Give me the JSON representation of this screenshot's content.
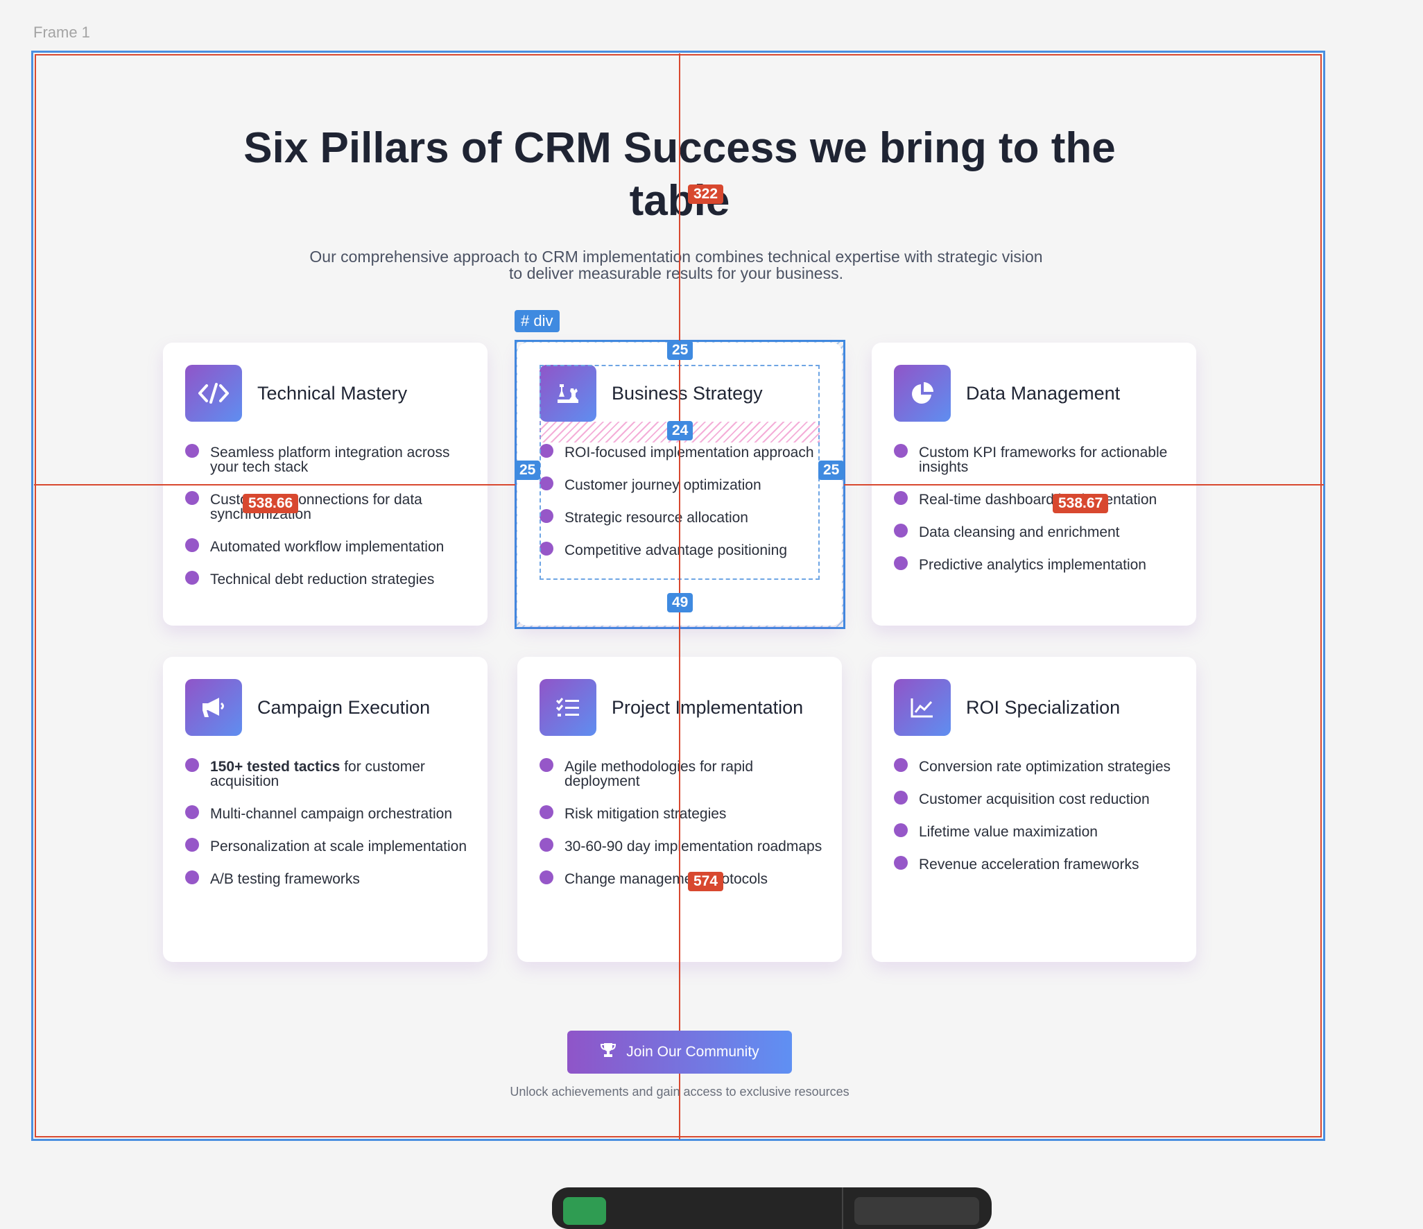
{
  "frame": {
    "label": "Frame 1"
  },
  "header": {
    "title": "Six Pillars of CRM Success we bring to the table",
    "subtitle": "Our comprehensive approach to CRM implementation combines technical expertise with strategic vision to deliver measurable results for your business."
  },
  "cards": [
    {
      "title": "Technical Mastery",
      "icon": "code-icon",
      "items": [
        "Seamless platform integration across your tech stack",
        "Custom API connections for data synchronization",
        "Automated workflow implementation",
        "Technical debt reduction strategies"
      ]
    },
    {
      "title": "Business Strategy",
      "icon": "chess-icon",
      "items": [
        "ROI-focused implementation approach",
        "Customer journey optimization",
        "Strategic resource allocation",
        "Competitive advantage positioning"
      ]
    },
    {
      "title": "Data Management",
      "icon": "pie-chart-icon",
      "items": [
        "Custom KPI frameworks for actionable insights",
        "Real-time dashboard implementation",
        "Data cleansing and enrichment",
        "Predictive analytics implementation"
      ]
    },
    {
      "title": "Campaign Execution",
      "icon": "megaphone-icon",
      "items_bold_prefix": "150+ tested tactics",
      "items": [
        " for customer acquisition",
        "Multi-channel campaign orchestration",
        "Personalization at scale implementation",
        "A/B testing frameworks"
      ]
    },
    {
      "title": "Project Implementation",
      "icon": "tasks-icon",
      "items": [
        "Agile methodologies for rapid deployment",
        "Risk mitigation strategies",
        "30-60-90 day implementation roadmaps",
        "Change management protocols"
      ]
    },
    {
      "title": "ROI Specialization",
      "icon": "line-chart-icon",
      "items": [
        "Conversion rate optimization strategies",
        "Customer acquisition cost reduction",
        "Lifetime value maximization",
        "Revenue acceleration frameworks"
      ]
    }
  ],
  "cta": {
    "label": "Join Our Community",
    "note": "Unlock achievements and gain access to exclusive resources",
    "icon": "trophy-icon"
  },
  "inspector": {
    "tag": "div",
    "padding_top": "25",
    "padding_left": "25",
    "padding_right": "25",
    "padding_bottom": "49",
    "gap": "24",
    "dist_title": "322",
    "dist_left": "538.66",
    "dist_right": "538.67",
    "dist_bottom": "574"
  }
}
